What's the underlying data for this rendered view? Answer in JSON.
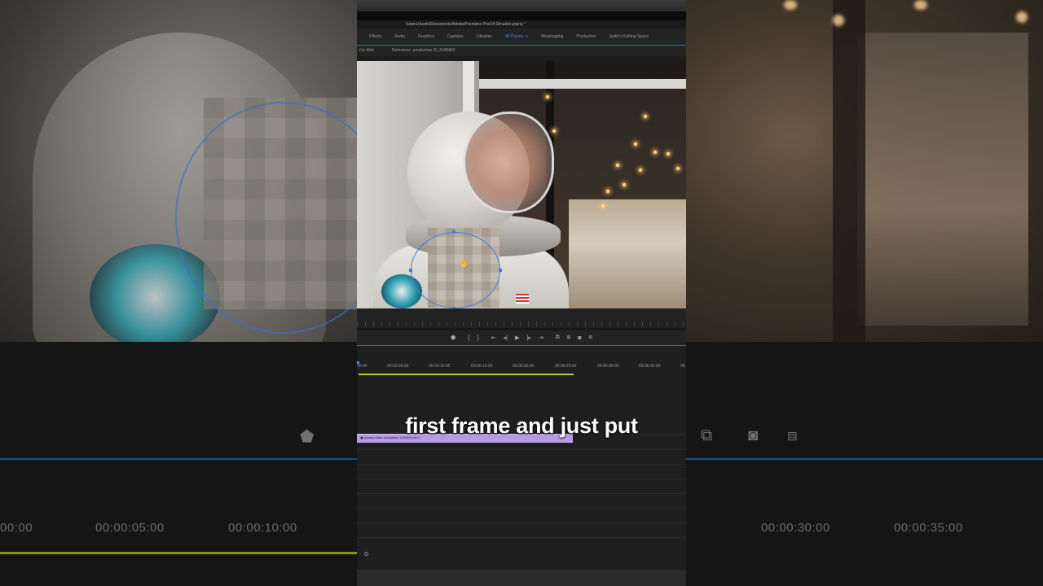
{
  "window": {
    "path": "/Users/Justin/Documents/Adobe/Premiere Pro/14.0/trackfx.prproj *"
  },
  "workspaces": [
    {
      "label": "Effects",
      "active": false
    },
    {
      "label": "Audio",
      "active": false
    },
    {
      "label": "Graphics",
      "active": false
    },
    {
      "label": "Captions",
      "active": false
    },
    {
      "label": "Libraries",
      "active": false
    },
    {
      "label": "All Panels",
      "active": true
    },
    {
      "label": "Metalogging",
      "active": false
    },
    {
      "label": "Production",
      "active": false
    },
    {
      "label": "Justin's Editing Space",
      "active": false
    }
  ],
  "monitor": {
    "left_label": "(no title)",
    "reference_label": "Reference: production ID_5186850"
  },
  "transport": {
    "buttons": [
      "marker",
      "mark-in",
      "mark-out",
      "go-to-in",
      "step-back",
      "play",
      "step-forward",
      "go-to-out",
      "insert",
      "overwrite",
      "export-frame",
      "button-editor"
    ]
  },
  "timeline": {
    "timecodes": [
      "00:00",
      "00:00:05:00",
      "00:00:10:00",
      "00:00:15:00",
      "00:00:20:00",
      "00:00:25:00",
      "00:00:30:00",
      "00:00:35:00",
      "00:"
    ],
    "clip_label": "pexels-video-kickstarter-1299569.mp4"
  },
  "background": {
    "left_timecodes": [
      "00:00",
      "00:00:05:00",
      "00:00:10:00"
    ],
    "right_timecodes": [
      "00:00:30:00",
      "00:00:35:00"
    ]
  },
  "caption": "first frame and just put",
  "colors": {
    "accent": "#3f8ee6",
    "clip": "#b69ae6",
    "work_area": "#bfcc22",
    "mask": "#3d7fd9"
  }
}
